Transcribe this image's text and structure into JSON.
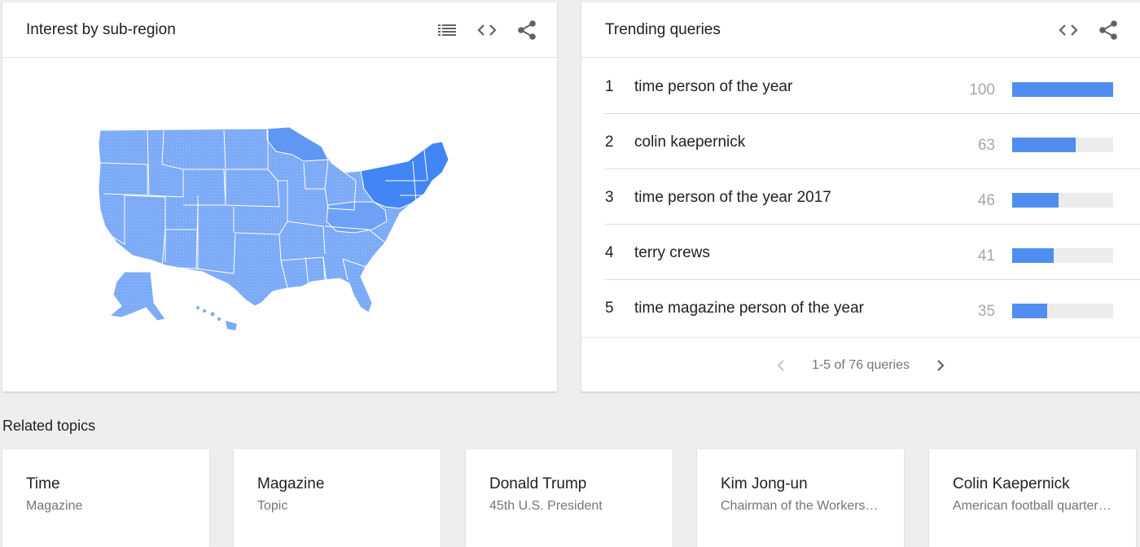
{
  "map_card": {
    "title": "Interest by sub-region",
    "icons": [
      "list-icon",
      "embed-code-icon",
      "share-icon"
    ]
  },
  "trending": {
    "title": "Trending queries",
    "icons": [
      "embed-code-icon",
      "share-icon"
    ],
    "rows": [
      {
        "rank": "1",
        "query": "time person of the year",
        "value": "100",
        "score": 100
      },
      {
        "rank": "2",
        "query": "colin kaepernick",
        "value": "63",
        "score": 63
      },
      {
        "rank": "3",
        "query": "time person of the year 2017",
        "value": "46",
        "score": 46
      },
      {
        "rank": "4",
        "query": "terry crews",
        "value": "41",
        "score": 41
      },
      {
        "rank": "5",
        "query": "time magazine person of the year",
        "value": "35",
        "score": 35
      }
    ],
    "pager": "1-5 of 76 queries"
  },
  "related": {
    "title": "Related topics",
    "topics": [
      {
        "name": "Time",
        "desc": "Magazine"
      },
      {
        "name": "Magazine",
        "desc": "Topic"
      },
      {
        "name": "Donald Trump",
        "desc": "45th U.S. President"
      },
      {
        "name": "Kim Jong-un",
        "desc": "Chairman of the Workers' Party of Korea"
      },
      {
        "name": "Colin Kaepernick",
        "desc": "American football quarterback"
      }
    ]
  },
  "colors": {
    "bar": "#4f8df0",
    "map_light": "#7baaf7",
    "map_mid": "#5e97f6",
    "map_dark": "#4285f4"
  }
}
